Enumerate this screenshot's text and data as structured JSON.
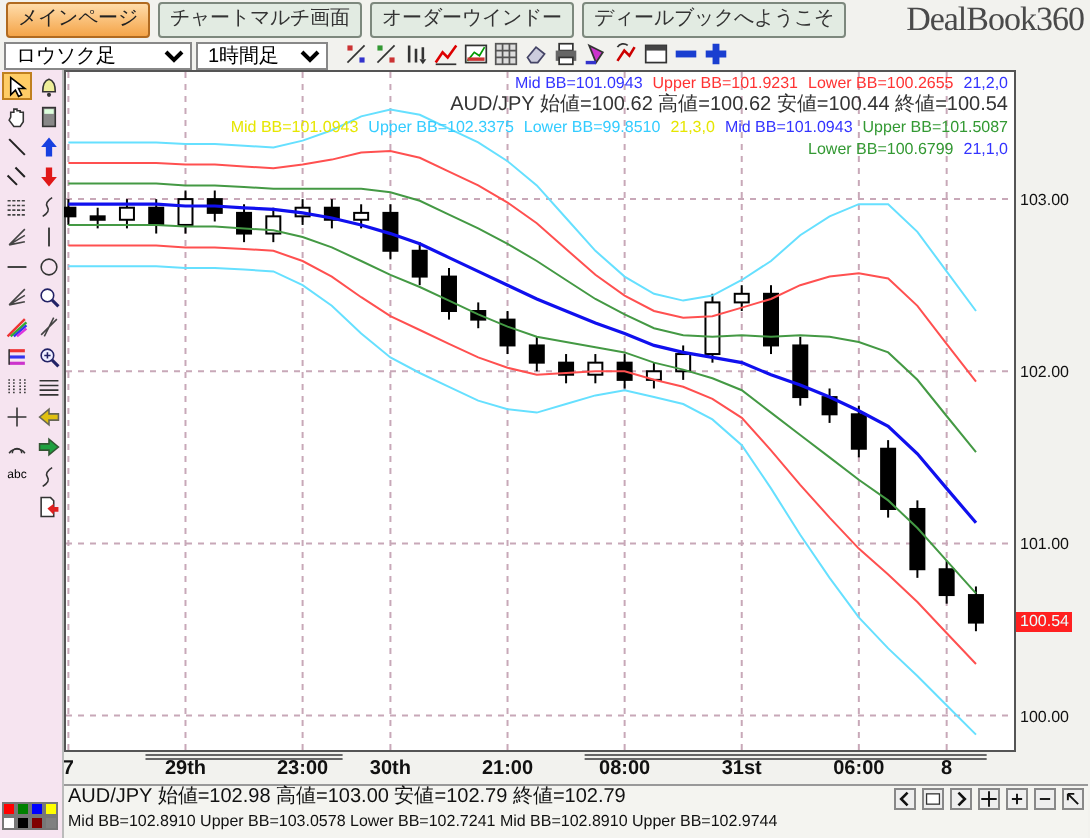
{
  "tabs": [
    {
      "label": "メインページ",
      "selected": true
    },
    {
      "label": "チャートマルチ画面",
      "selected": false
    },
    {
      "label": "オーダーウインドー",
      "selected": false
    },
    {
      "label": "ディールブックへようこそ",
      "selected": false
    }
  ],
  "logo": "DealBook360",
  "toolbar": {
    "chart_type": "ロウソク足",
    "timeframe": "1時間足"
  },
  "tools": [
    {
      "kind": "cursor",
      "selected": true
    },
    {
      "kind": "bell",
      "selected": false
    },
    {
      "kind": "hand",
      "selected": false
    },
    {
      "kind": "calculator",
      "selected": false
    },
    {
      "kind": "line",
      "selected": false
    },
    {
      "kind": "arrow-up",
      "selected": false
    },
    {
      "kind": "parallel",
      "selected": false
    },
    {
      "kind": "arrow-down",
      "selected": false
    },
    {
      "kind": "levels",
      "selected": false
    },
    {
      "kind": "wave",
      "selected": false
    },
    {
      "kind": "fan",
      "selected": false
    },
    {
      "kind": "vline",
      "selected": false
    },
    {
      "kind": "hline",
      "selected": false
    },
    {
      "kind": "circle",
      "selected": false
    },
    {
      "kind": "fan",
      "selected": false
    },
    {
      "kind": "magnifier",
      "selected": false
    },
    {
      "kind": "rainbow",
      "selected": false
    },
    {
      "kind": "crossing",
      "selected": false
    },
    {
      "kind": "bars",
      "selected": false
    },
    {
      "kind": "zoom",
      "selected": false
    },
    {
      "kind": "grid",
      "selected": false
    },
    {
      "kind": "lines",
      "selected": false
    },
    {
      "kind": "crosshair",
      "selected": false
    },
    {
      "kind": "arrow-left",
      "selected": false
    },
    {
      "kind": "arc",
      "selected": false
    },
    {
      "kind": "arrow-right",
      "selected": false
    },
    {
      "kind": "text",
      "label": "abc",
      "selected": false
    },
    {
      "kind": "wave",
      "selected": false
    },
    {
      "kind": "page-arrow",
      "selected": false
    }
  ],
  "palette_colors": [
    {
      "color": "#ff0000"
    },
    {
      "color": "#008000"
    },
    {
      "color": "#0000ff"
    },
    {
      "color": "#ffff00"
    },
    {
      "color": "#ffffff"
    },
    {
      "color": "#000000"
    },
    {
      "color": "#800000"
    },
    {
      "color": "#808080"
    }
  ],
  "legend": [
    [
      {
        "text": "Mid BB=101.0943",
        "color": "#3333ff"
      },
      {
        "text": "Upper BB=101.9231",
        "color": "#ff3333"
      },
      {
        "text": "Lower BB=100.2655",
        "color": "#ff3333"
      },
      {
        "text": "21,2,0",
        "color": "#3333ff"
      },
      {
        "text": "AUD/JPY 始値=100.62 高値=100.62 安値=100.44 終値=100.54",
        "color": "#333333"
      }
    ],
    [
      {
        "text": "Mid BB=101.0943",
        "color": "#e6e600"
      },
      {
        "text": "Upper BB=102.3375",
        "color": "#33ccff"
      },
      {
        "text": "Lower BB=99.8510",
        "color": "#33ccff"
      },
      {
        "text": "21,3,0",
        "color": "#e6e600"
      },
      {
        "text": "Mid BB=101.0943",
        "color": "#3333ff"
      },
      {
        "text": "Upper BB=101.5087",
        "color": "#339933"
      },
      {
        "text": "Lower BB=100.6799",
        "color": "#339933"
      },
      {
        "text": "21,1,0",
        "color": "#3333ff"
      }
    ]
  ],
  "chart": {
    "price_label": "100.54",
    "chart_data": {
      "type": "candlestick",
      "grid": true,
      "ylim": [
        99.8,
        103.75
      ],
      "categories": [
        "7",
        null,
        null,
        null,
        "29th",
        null,
        null,
        null,
        "23:00",
        null,
        null,
        "30th",
        null,
        null,
        null,
        "21:00",
        null,
        null,
        null,
        "08:00",
        null,
        null,
        null,
        "31st",
        null,
        null,
        null,
        "06:00",
        null,
        null,
        "8",
        null
      ],
      "yticks": [
        {
          "value": 100,
          "label": "100.00"
        },
        {
          "value": 101,
          "label": "101.00"
        },
        {
          "value": 102,
          "label": "102.00"
        },
        {
          "value": 103,
          "label": "103.00"
        }
      ],
      "ohlc": [
        [
          102.95,
          103.0,
          102.85,
          102.9
        ],
        [
          102.9,
          102.95,
          102.83,
          102.88
        ],
        [
          102.88,
          103.0,
          102.83,
          102.95
        ],
        [
          102.95,
          103.0,
          102.8,
          102.85
        ],
        [
          102.85,
          103.05,
          102.8,
          103.0
        ],
        [
          103.0,
          103.05,
          102.87,
          102.92
        ],
        [
          102.92,
          102.97,
          102.75,
          102.8
        ],
        [
          102.8,
          102.95,
          102.75,
          102.9
        ],
        [
          102.9,
          103.0,
          102.85,
          102.95
        ],
        [
          102.95,
          103.0,
          102.83,
          102.88
        ],
        [
          102.88,
          102.97,
          102.83,
          102.92
        ],
        [
          102.92,
          102.97,
          102.65,
          102.7
        ],
        [
          102.7,
          102.75,
          102.5,
          102.55
        ],
        [
          102.55,
          102.6,
          102.3,
          102.35
        ],
        [
          102.35,
          102.4,
          102.25,
          102.3
        ],
        [
          102.3,
          102.35,
          102.1,
          102.15
        ],
        [
          102.15,
          102.2,
          102.0,
          102.05
        ],
        [
          102.05,
          102.1,
          101.93,
          101.98
        ],
        [
          101.98,
          102.1,
          101.93,
          102.05
        ],
        [
          102.05,
          102.1,
          101.9,
          101.95
        ],
        [
          101.95,
          102.05,
          101.9,
          102.0
        ],
        [
          102.0,
          102.15,
          101.95,
          102.1
        ],
        [
          102.1,
          102.45,
          102.05,
          102.4
        ],
        [
          102.4,
          102.5,
          102.35,
          102.45
        ],
        [
          102.45,
          102.5,
          102.1,
          102.15
        ],
        [
          102.15,
          102.2,
          101.8,
          101.85
        ],
        [
          101.85,
          101.9,
          101.7,
          101.75
        ],
        [
          101.75,
          101.8,
          101.5,
          101.55
        ],
        [
          101.55,
          101.6,
          101.15,
          101.2
        ],
        [
          101.2,
          101.25,
          100.8,
          100.85
        ],
        [
          100.85,
          100.9,
          100.65,
          100.7
        ],
        [
          100.7,
          100.75,
          100.49,
          100.54
        ]
      ],
      "series": [
        {
          "type": "line",
          "color": "#66e0ff",
          "values": [
            103.33,
            103.33,
            103.33,
            103.33,
            103.32,
            103.32,
            103.31,
            103.3,
            103.34,
            103.4,
            103.48,
            103.52,
            103.49,
            103.41,
            103.33,
            103.22,
            103.08,
            102.89,
            102.7,
            102.55,
            102.45,
            102.41,
            102.44,
            102.53,
            102.64,
            102.79,
            102.9,
            102.97,
            102.97,
            102.81,
            102.58,
            102.35
          ]
        },
        {
          "type": "line",
          "color": "#ff5050",
          "values": [
            103.21,
            103.21,
            103.21,
            103.21,
            103.2,
            103.2,
            103.19,
            103.18,
            103.2,
            103.23,
            103.27,
            103.28,
            103.24,
            103.16,
            103.08,
            102.98,
            102.86,
            102.71,
            102.56,
            102.44,
            102.35,
            102.31,
            102.32,
            102.37,
            102.42,
            102.5,
            102.55,
            102.57,
            102.54,
            102.38,
            102.16,
            101.94
          ]
        },
        {
          "type": "line",
          "color": "#449944",
          "values": [
            103.09,
            103.09,
            103.09,
            103.09,
            103.08,
            103.08,
            103.07,
            103.06,
            103.06,
            103.06,
            103.06,
            103.04,
            102.99,
            102.91,
            102.83,
            102.74,
            102.64,
            102.53,
            102.42,
            102.33,
            102.25,
            102.21,
            102.2,
            102.21,
            102.2,
            102.21,
            102.2,
            102.17,
            102.11,
            101.95,
            101.74,
            101.53
          ]
        },
        {
          "type": "line",
          "color": "#1010ee",
          "values": [
            102.97,
            102.97,
            102.97,
            102.97,
            102.96,
            102.96,
            102.95,
            102.94,
            102.92,
            102.89,
            102.85,
            102.8,
            102.74,
            102.66,
            102.58,
            102.5,
            102.42,
            102.35,
            102.28,
            102.22,
            102.15,
            102.11,
            102.08,
            102.05,
            101.98,
            101.92,
            101.85,
            101.77,
            101.68,
            101.52,
            101.32,
            101.12
          ]
        },
        {
          "type": "line",
          "color": "#449944",
          "values": [
            102.85,
            102.85,
            102.85,
            102.85,
            102.84,
            102.84,
            102.83,
            102.82,
            102.78,
            102.72,
            102.64,
            102.56,
            102.49,
            102.41,
            102.33,
            102.26,
            102.2,
            102.17,
            102.14,
            102.11,
            102.05,
            102.01,
            101.96,
            101.89,
            101.76,
            101.63,
            101.5,
            101.37,
            101.25,
            101.09,
            100.9,
            100.71
          ]
        },
        {
          "type": "line",
          "color": "#ff5050",
          "values": [
            102.73,
            102.73,
            102.73,
            102.73,
            102.72,
            102.72,
            102.71,
            102.7,
            102.64,
            102.55,
            102.43,
            102.32,
            102.24,
            102.16,
            102.08,
            102.02,
            101.98,
            101.99,
            102.0,
            102.0,
            101.95,
            101.91,
            101.84,
            101.73,
            101.54,
            101.34,
            101.15,
            100.97,
            100.82,
            100.66,
            100.48,
            100.3
          ]
        },
        {
          "type": "line",
          "color": "#66e0ff",
          "values": [
            102.61,
            102.61,
            102.61,
            102.61,
            102.6,
            102.6,
            102.59,
            102.58,
            102.5,
            102.38,
            102.22,
            102.08,
            101.99,
            101.91,
            101.83,
            101.78,
            101.76,
            101.81,
            101.86,
            101.89,
            101.85,
            101.81,
            101.72,
            101.57,
            101.32,
            101.05,
            100.8,
            100.57,
            100.39,
            100.23,
            100.06,
            99.89
          ]
        }
      ]
    }
  },
  "status_bar": {
    "quote": "AUD/JPY 始値=102.98 高値=103.00 安値=102.79 終値=102.79",
    "bands": "Mid BB=102.8910 Upper BB=103.0578 Lower BB=102.7241 Mid BB=102.8910 Upper BB=102.9744"
  }
}
